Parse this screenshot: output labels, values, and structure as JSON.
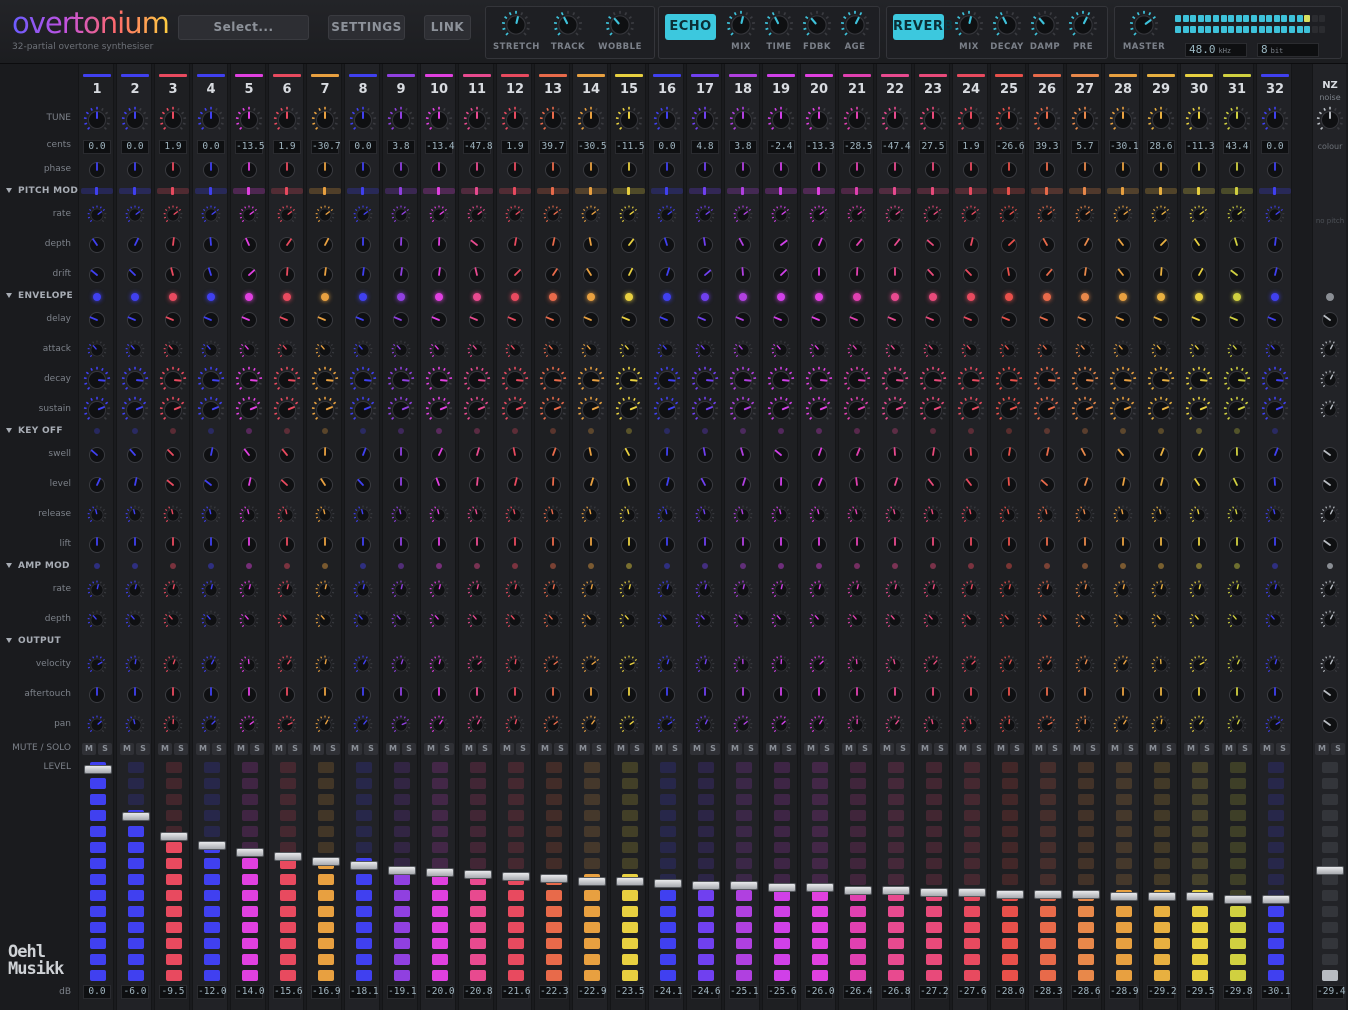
{
  "app": {
    "title": "overtonium",
    "tagline": "32-partial overtone synthesiser"
  },
  "toolbar": {
    "preset": "Select...",
    "settings": "SETTINGS",
    "link": "LINK"
  },
  "global_knobs": [
    {
      "label": "STRETCH"
    },
    {
      "label": "TRACK"
    },
    {
      "label": "WOBBLE"
    }
  ],
  "echo": {
    "button": "ECHO",
    "knobs": [
      {
        "label": "MIX"
      },
      {
        "label": "TIME"
      },
      {
        "label": "FDBK"
      },
      {
        "label": "AGE"
      }
    ]
  },
  "reverb": {
    "button": "REVERB",
    "knobs": [
      {
        "label": "MIX"
      },
      {
        "label": "DECAY"
      },
      {
        "label": "DAMP"
      },
      {
        "label": "PRE"
      }
    ]
  },
  "master": {
    "label": "MASTER",
    "rate": "48.0",
    "rate_unit": "kHz",
    "bits": "8",
    "bits_unit": "bit"
  },
  "rows": {
    "tune": "TUNE",
    "cents": "cents",
    "phase": "phase",
    "pitch_mod": "PITCH MOD",
    "pm_rate": "rate",
    "pm_depth": "depth",
    "pm_drift": "drift",
    "envelope": "ENVELOPE",
    "delay": "delay",
    "attack": "attack",
    "decay": "decay",
    "sustain": "sustain",
    "key_off": "KEY OFF",
    "swell": "swell",
    "level": "level",
    "release": "release",
    "lift": "lift",
    "amp_mod": "AMP MOD",
    "am_rate": "rate",
    "am_depth": "depth",
    "output": "OUTPUT",
    "velocity": "velocity",
    "aftertouch": "aftertouch",
    "pan": "pan",
    "mute_solo": "MUTE / SOLO",
    "level_fader": "LEVEL",
    "db": "dB"
  },
  "mute_label": "M",
  "solo_label": "S",
  "noise": {
    "title": "NZ",
    "subtitle": "noise",
    "colour": "colour",
    "no_pitch": "no pitch",
    "db": "-29.4",
    "level": 0.04
  },
  "brand": {
    "line1": "Oehl",
    "line2": "Musikk"
  },
  "partials": [
    {
      "n": "1",
      "cents": "0.0",
      "db": "0.0",
      "color": "#4040f0",
      "level": 0.97
    },
    {
      "n": "2",
      "cents": "0.0",
      "db": "-6.0",
      "color": "#4040f0",
      "level": 0.76
    },
    {
      "n": "3",
      "cents": "1.9",
      "db": "-9.5",
      "color": "#e84a5f",
      "level": 0.67
    },
    {
      "n": "4",
      "cents": "0.0",
      "db": "-12.0",
      "color": "#4040f0",
      "level": 0.63
    },
    {
      "n": "5",
      "cents": "-13.5",
      "db": "-14.0",
      "color": "#e040e0",
      "level": 0.6
    },
    {
      "n": "6",
      "cents": "1.9",
      "db": "-15.6",
      "color": "#e84a5f",
      "level": 0.58
    },
    {
      "n": "7",
      "cents": "-30.7",
      "db": "-16.9",
      "color": "#e8a040",
      "level": 0.56
    },
    {
      "n": "8",
      "cents": "0.0",
      "db": "-18.1",
      "color": "#4040f0",
      "level": 0.54
    },
    {
      "n": "9",
      "cents": "3.8",
      "db": "-19.1",
      "color": "#9040e0",
      "level": 0.52
    },
    {
      "n": "10",
      "cents": "-13.4",
      "db": "-20.0",
      "color": "#e040e0",
      "level": 0.51
    },
    {
      "n": "11",
      "cents": "-47.8",
      "db": "-20.8",
      "color": "#e84a8f",
      "level": 0.5
    },
    {
      "n": "12",
      "cents": "1.9",
      "db": "-21.6",
      "color": "#e84a5f",
      "level": 0.49
    },
    {
      "n": "13",
      "cents": "39.7",
      "db": "-22.3",
      "color": "#e86a4a",
      "level": 0.48
    },
    {
      "n": "14",
      "cents": "-30.5",
      "db": "-22.9",
      "color": "#e8a040",
      "level": 0.47
    },
    {
      "n": "15",
      "cents": "-11.5",
      "db": "-23.5",
      "color": "#e8d040",
      "level": 0.47
    },
    {
      "n": "16",
      "cents": "0.0",
      "db": "-24.1",
      "color": "#4040f0",
      "level": 0.46
    },
    {
      "n": "17",
      "cents": "4.8",
      "db": "-24.6",
      "color": "#7040f0",
      "level": 0.45
    },
    {
      "n": "18",
      "cents": "3.8",
      "db": "-25.1",
      "color": "#b040e0",
      "level": 0.45
    },
    {
      "n": "19",
      "cents": "-2.4",
      "db": "-25.6",
      "color": "#d040e8",
      "level": 0.44
    },
    {
      "n": "20",
      "cents": "-13.3",
      "db": "-26.0",
      "color": "#e040e0",
      "level": 0.44
    },
    {
      "n": "21",
      "cents": "-28.5",
      "db": "-26.4",
      "color": "#e040b0",
      "level": 0.43
    },
    {
      "n": "22",
      "cents": "-47.4",
      "db": "-26.8",
      "color": "#e84a8f",
      "level": 0.43
    },
    {
      "n": "23",
      "cents": "27.5",
      "db": "-27.2",
      "color": "#e84a7a",
      "level": 0.42
    },
    {
      "n": "24",
      "cents": "1.9",
      "db": "-27.6",
      "color": "#e84a5f",
      "level": 0.42
    },
    {
      "n": "25",
      "cents": "-26.6",
      "db": "-28.0",
      "color": "#e8504a",
      "level": 0.41
    },
    {
      "n": "26",
      "cents": "39.3",
      "db": "-28.3",
      "color": "#e86a4a",
      "level": 0.41
    },
    {
      "n": "27",
      "cents": "5.7",
      "db": "-28.6",
      "color": "#e8884a",
      "level": 0.41
    },
    {
      "n": "28",
      "cents": "-30.1",
      "db": "-28.9",
      "color": "#e8a040",
      "level": 0.4
    },
    {
      "n": "29",
      "cents": "28.6",
      "db": "-29.2",
      "color": "#e8b040",
      "level": 0.4
    },
    {
      "n": "30",
      "cents": "-11.3",
      "db": "-29.5",
      "color": "#e8d040",
      "level": 0.4
    },
    {
      "n": "31",
      "cents": "43.4",
      "db": "-29.8",
      "color": "#d0d040",
      "level": 0.39
    },
    {
      "n": "32",
      "cents": "0.0",
      "db": "-30.1",
      "color": "#4040f0",
      "level": 0.39
    }
  ]
}
